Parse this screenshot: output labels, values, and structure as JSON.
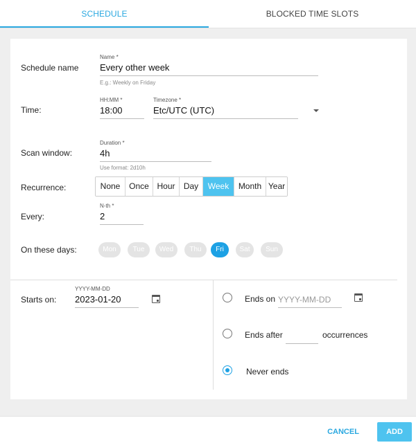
{
  "tabs": [
    {
      "label": "SCHEDULE",
      "active": true
    },
    {
      "label": "BLOCKED TIME SLOTS",
      "active": false
    }
  ],
  "form": {
    "schedule_name": {
      "row_label": "Schedule name",
      "field_label": "Name *",
      "value": "Every other week",
      "hint": "E.g.: Weekly on Friday"
    },
    "time": {
      "row_label": "Time:",
      "field_label": "HH:MM *",
      "value": "18:00"
    },
    "timezone": {
      "field_label": "Timezone *",
      "value": "Etc/UTC (UTC)"
    },
    "scan_window": {
      "row_label": "Scan window:",
      "field_label": "Duration *",
      "value": "4h",
      "hint": "Use format: 2d10h"
    },
    "recurrence": {
      "row_label": "Recurrence:",
      "options": [
        "None",
        "Once",
        "Hour",
        "Day",
        "Week",
        "Month",
        "Year"
      ],
      "selected": "Week"
    },
    "every": {
      "row_label": "Every:",
      "field_label": "N-th *",
      "value": "2"
    },
    "days": {
      "row_label": "On these days:",
      "options": [
        "Mon",
        "Tue",
        "Wed",
        "Thu",
        "Fri",
        "Sat",
        "Sun"
      ],
      "selected": [
        "Fri"
      ]
    },
    "starts_on": {
      "row_label": "Starts on:",
      "field_label": "YYYY-MM-DD",
      "value": "2023-01-20"
    },
    "ends": {
      "ends_on_label": "Ends on",
      "ends_on_placeholder": "YYYY-MM-DD",
      "ends_after_label": "Ends after",
      "ends_after_value": "",
      "occurrences_label": "occurrences",
      "never_label": "Never ends",
      "selected": "never"
    }
  },
  "footer": {
    "cancel_label": "CANCEL",
    "add_label": "ADD"
  },
  "colors": {
    "accent": "#2aa8e0",
    "active_button": "#4ec3ef",
    "day_active": "#1da1e4"
  }
}
